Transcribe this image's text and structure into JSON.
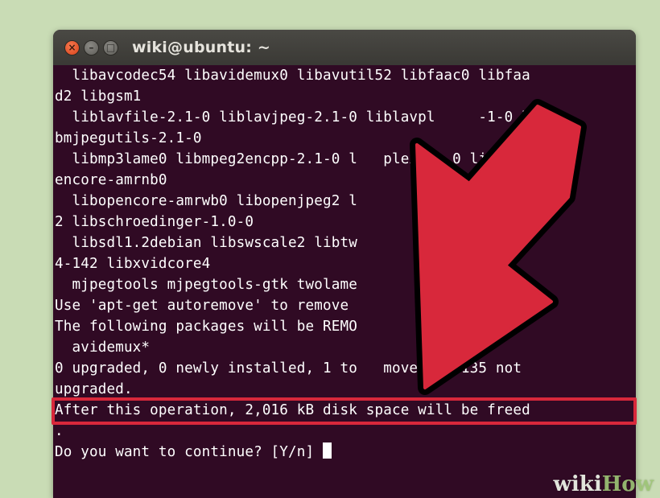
{
  "window": {
    "title": "wiki@ubuntu: ~"
  },
  "terminal": {
    "lines": [
      "  libavcodec54 libavidemux0 libavutil52 libfaac0 libfaa",
      "d2 libgsm1",
      "  liblavfile-2.1-0 liblavjpeg-2.1-0 liblavpl     -1-0 li",
      "bmjpegutils-2.1-0",
      "  libmp3lame0 libmpeg2encpp-2.1-0 l   plex1   0 libop",
      "encore-amrnb0",
      "  libopencore-amrwb0 libopenjpeg2 l        quicktime",
      "2 libschroedinger-1.0-0",
      "  libsdl1.2debian libswscale2 libtw            bx26",
      "4-142 libxvidcore4",
      "  mjpegtools mjpegtools-gtk twolame",
      "Use 'apt-get autoremove' to remove",
      "The following packages will be REMO",
      "  avidemux*",
      "0 upgraded, 0 newly installed, 1 to   move and 135 not",
      "upgraded.",
      "After this operation, 2,016 kB disk space will be freed",
      ".",
      "Do you want to continue? [Y/n] "
    ]
  },
  "colors": {
    "terminal_bg": "#300a24",
    "annotation_red": "#d8283b",
    "page_bg": "#c9dcb5"
  },
  "watermark": {
    "wiki": "wiki",
    "how": "How"
  }
}
